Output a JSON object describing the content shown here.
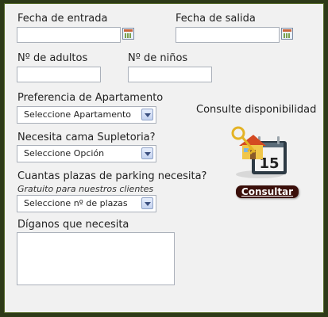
{
  "form": {
    "check_in_label": "Fecha de entrada",
    "check_out_label": "Fecha de salida",
    "adults_label": "Nº de adultos",
    "children_label": "Nº de niños",
    "apartment_label": "Preferencia de Apartamento",
    "apartment_selected": "Seleccione Apartamento",
    "extra_bed_label": "Necesita cama Supletoria?",
    "extra_bed_selected": "Seleccione Opción",
    "parking_label": "Cuantas plazas de parking necesita?",
    "parking_note": "Gratuito para nuestros clientes",
    "parking_selected": "Seleccione nº de plazas",
    "comments_label": "Díganos que necesita"
  },
  "availability": {
    "title": "Consulte disponibilidad",
    "calendar_day": "15",
    "button_label": "Consultar"
  },
  "icons": {
    "calendar_picker": "calendar-icon",
    "booking_illustration": "house-key-calendar-icon"
  },
  "colors": {
    "page_background": "#2e3a18",
    "panel_background": "#f1f1f1",
    "button_background": "#3a0f0a"
  }
}
